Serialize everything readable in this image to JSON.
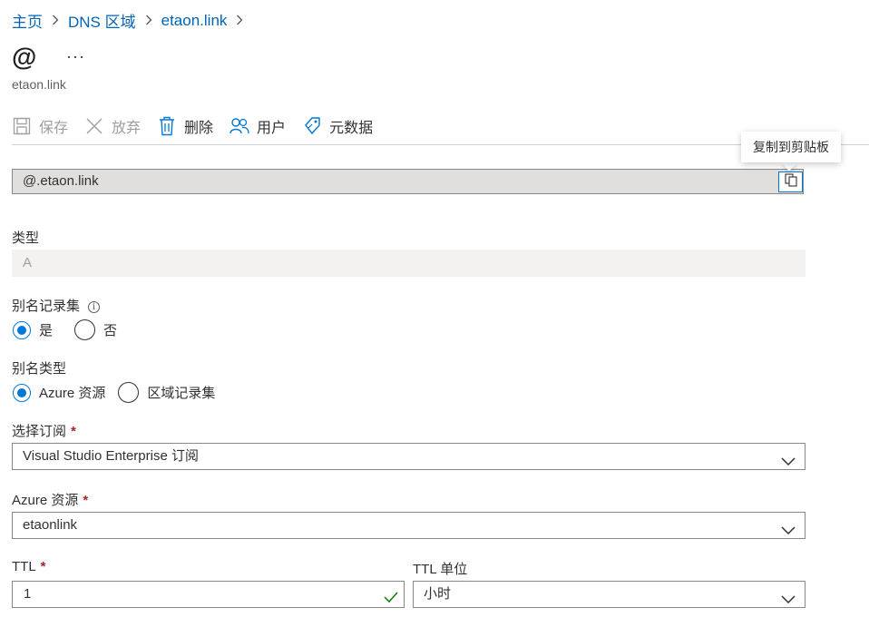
{
  "breadcrumb": [
    {
      "label": "主页"
    },
    {
      "label": "DNS 区域"
    },
    {
      "label": "etaon.link"
    }
  ],
  "header": {
    "title": "@",
    "more": "···",
    "subtitle": "etaon.link"
  },
  "toolbar": {
    "save": "保存",
    "discard": "放弃",
    "delete": "删除",
    "users": "用户",
    "metadata": "元数据"
  },
  "tooltip": "复制到剪贴板",
  "record_name": "@.etaon.link",
  "type": {
    "label": "类型",
    "value": "A"
  },
  "alias_record_set": {
    "label": "别名记录集",
    "options": [
      "是",
      "否"
    ],
    "selected": "是"
  },
  "alias_type": {
    "label": "别名类型",
    "options": [
      "Azure 资源",
      "区域记录集"
    ],
    "selected": "Azure 资源"
  },
  "subscription": {
    "label": "选择订阅",
    "required_mark": "*",
    "value": "Visual Studio Enterprise 订阅"
  },
  "azure_resource": {
    "label": "Azure 资源",
    "required_mark": "*",
    "value": "etaonlink"
  },
  "ttl": {
    "label": "TTL",
    "required_mark": "*",
    "value": "1"
  },
  "ttl_unit": {
    "label": "TTL 单位",
    "value": "小时"
  },
  "colors": {
    "accent": "#0078d4",
    "link": "#0064b4",
    "required": "#a4262c",
    "valid": "#107c10"
  }
}
